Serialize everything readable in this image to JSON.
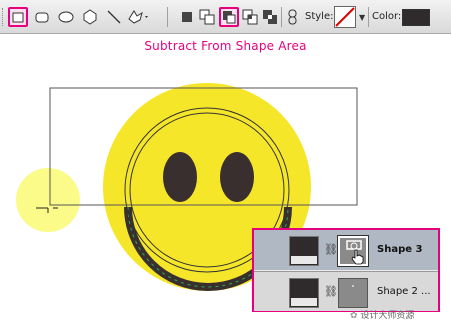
{
  "toolbar": {
    "shape_tools": [
      "rectangle-tool-icon",
      "rounded-rectangle-tool-icon",
      "ellipse-tool-icon",
      "polygon-tool-icon",
      "line-tool-icon",
      "custom-shape-tool-icon"
    ],
    "path_ops": [
      "create-new-shape-layer-icon",
      "add-to-shape-area-icon",
      "subtract-from-shape-area-icon",
      "intersect-shape-areas-icon",
      "exclude-overlapping-shape-areas-icon"
    ],
    "selected_path_op": "subtract-from-shape-area-icon",
    "style_label": "Style:",
    "color_label": "Color:",
    "color_value": "#2f2a2b",
    "accent": "#e6007e"
  },
  "caption": "Subtract From Shape Area",
  "layers": [
    {
      "name": "Shape 3",
      "active": true
    },
    {
      "name": "Shape 2 ...",
      "active": false
    }
  ],
  "watermark": "设计大师资源",
  "colors": {
    "smiley_fill": "#f6e62a",
    "smiley_features": "#3a2f2f",
    "highlight": "#fbfb8a"
  }
}
